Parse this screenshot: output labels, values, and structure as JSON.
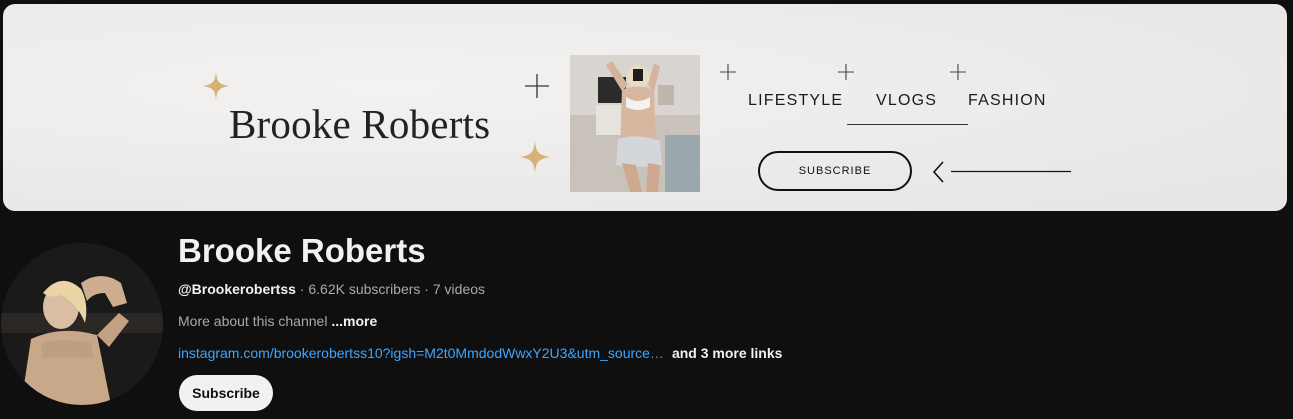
{
  "banner": {
    "title": "Brooke Roberts",
    "nav": [
      "LIFESTYLE",
      "VLOGS",
      "FASHION"
    ],
    "subscribe_label": "SUBSCRIBE",
    "accent_color": "#d8b07a"
  },
  "channel": {
    "name": "Brooke Roberts",
    "handle": "@Brookerobertss",
    "subscribers": "6.62K subscribers",
    "videos": "7 videos",
    "separator": " · ",
    "about_text": "More about this channel",
    "about_more": "...more",
    "link_text": "instagram.com/brookerobertss10?igsh=M2t0MmdodWwxY2U3&utm_source…",
    "more_links": "and 3 more links",
    "subscribe_label": "Subscribe"
  },
  "colors": {
    "background": "#0f0f0f",
    "link": "#3ea6ff",
    "muted_text": "#aaaaaa",
    "primary_text": "#f1f1f1"
  }
}
